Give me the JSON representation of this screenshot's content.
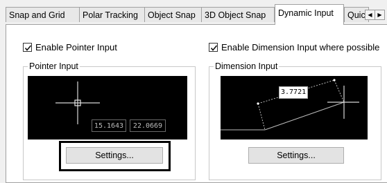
{
  "tabs": [
    {
      "label": "Snap and Grid"
    },
    {
      "label": "Polar Tracking"
    },
    {
      "label": "Object Snap"
    },
    {
      "label": "3D Object Snap"
    },
    {
      "label": "Dynamic Input"
    },
    {
      "label": "Quic"
    }
  ],
  "active_tab": "Dynamic Input",
  "pointer": {
    "checkbox_label": "Enable Pointer Input",
    "checked": true,
    "group_label": "Pointer Input",
    "readout_x": "15.1643",
    "readout_y": "22.0669",
    "settings_label": "Settings..."
  },
  "dimension": {
    "checkbox_label": "Enable Dimension Input where possible",
    "checked": true,
    "group_label": "Dimension Input",
    "readout_value": "3.7721",
    "settings_label": "Settings..."
  }
}
